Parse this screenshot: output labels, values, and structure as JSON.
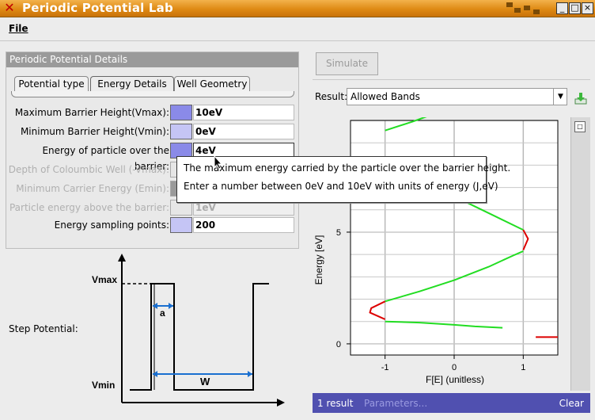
{
  "window": {
    "title": "Periodic Potential Lab",
    "controls": [
      "_",
      "□",
      "×"
    ]
  },
  "menu": {
    "file": "File"
  },
  "details": {
    "header": "Periodic Potential Details",
    "tabs": [
      "Potential type",
      "Energy Details",
      "Well Geometry"
    ],
    "active_tab": "Energy Details",
    "fields": [
      {
        "label": "Maximum Barrier Height(Vmax):",
        "value": "10eV",
        "enabled": true
      },
      {
        "label": "Minimum Barrier Height(Vmin):",
        "value": "0eV",
        "enabled": true
      },
      {
        "label": "Energy of  particle over the barrier:",
        "value": "4eV",
        "enabled": true
      },
      {
        "label": "Depth of Coloumbic Well (-Vmax):",
        "value": "",
        "enabled": false
      },
      {
        "label": "Minimum Carrier Energy (Emin):",
        "value": "",
        "enabled": false
      },
      {
        "label": "Particle energy above the barrier:",
        "value": "1eV",
        "enabled": false
      },
      {
        "label": "Energy sampling points:",
        "value": "200",
        "enabled": true
      }
    ]
  },
  "tooltip": {
    "line1": "The maximum energy carried by the particle over the barrier height.",
    "line2": "Enter a number between 0eV and 10eV with units of energy (J,eV)"
  },
  "diagram": {
    "caption": "Step Potential:",
    "vmax_label": "Vmax",
    "vmin_label": "Vmin",
    "a_label": "a",
    "w_label": "W"
  },
  "simulate_label": "Simulate",
  "result": {
    "label": "Result:",
    "selected": "Allowed Bands"
  },
  "status": {
    "count": "1 result",
    "params": "Parameters...",
    "clear": "Clear"
  },
  "colors": {
    "band_curve": "#22dd22",
    "forbidden_curve": "#dd0000",
    "status_bg": "#5050b0"
  },
  "chart_data": {
    "type": "line",
    "xlabel": "F[E] (unitless)",
    "ylabel": "Energy  [eV]",
    "xlim": [
      -1.5,
      1.5
    ],
    "ylim": [
      -0.5,
      10
    ],
    "x_ticks": [
      -1,
      0,
      1
    ],
    "y_ticks": [
      0,
      5
    ],
    "grid": true,
    "series": [
      {
        "color": "#22dd22",
        "points": [
          [
            -1,
            1.0
          ],
          [
            -0.5,
            0.95
          ],
          [
            0,
            0.85
          ],
          [
            0.3,
            0.78
          ],
          [
            0.7,
            0.72
          ]
        ]
      },
      {
        "color": "#22dd22",
        "points": [
          [
            -1,
            1.9
          ],
          [
            -0.5,
            2.35
          ],
          [
            0,
            2.85
          ],
          [
            0.5,
            3.45
          ],
          [
            0.85,
            3.95
          ],
          [
            1,
            4.15
          ]
        ]
      },
      {
        "color": "#22dd22",
        "points": [
          [
            1,
            5.1
          ],
          [
            0.6,
            5.7
          ],
          [
            0.2,
            6.3
          ],
          [
            -0.3,
            6.85
          ],
          [
            -0.8,
            7.55
          ],
          [
            -1,
            8.0
          ]
        ]
      },
      {
        "color": "#22dd22",
        "points": [
          [
            -1,
            9.55
          ],
          [
            -0.6,
            9.95
          ],
          [
            -0.15,
            10.45
          ],
          [
            0.4,
            11.3
          ]
        ]
      },
      {
        "color": "#dd0000",
        "points": [
          [
            -1,
            1.9
          ],
          [
            -1.2,
            1.6
          ],
          [
            -1.22,
            1.4
          ],
          [
            -1,
            1.1
          ]
        ]
      },
      {
        "color": "#dd0000",
        "points": [
          [
            1,
            5.1
          ],
          [
            1.07,
            4.7
          ],
          [
            1,
            4.2
          ]
        ]
      },
      {
        "color": "#dd0000",
        "points": [
          [
            1.18,
            0.3
          ],
          [
            1.5,
            0.3
          ]
        ]
      }
    ]
  }
}
